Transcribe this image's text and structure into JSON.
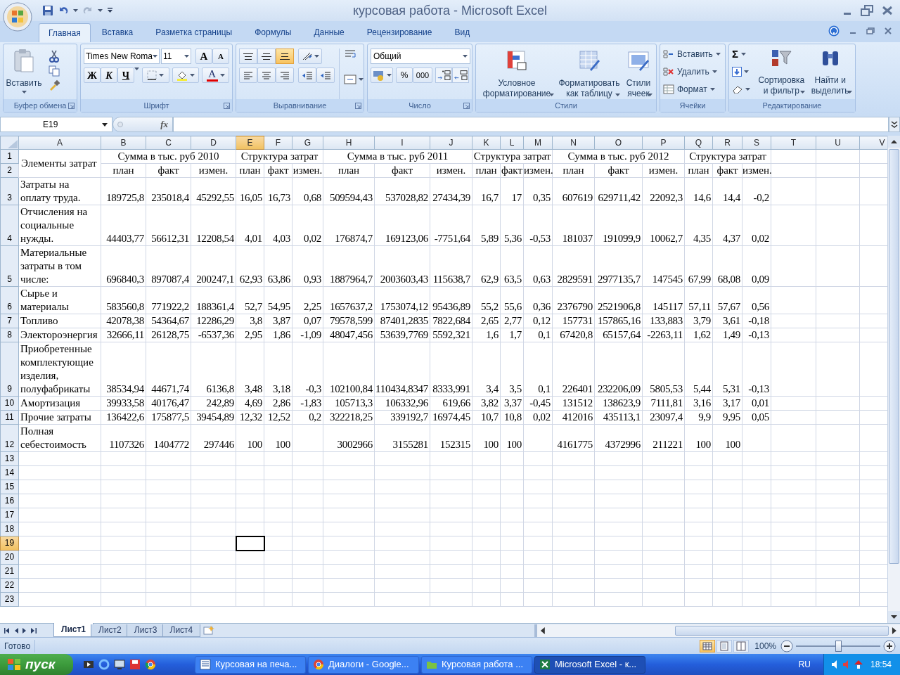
{
  "window": {
    "title": "курсовая работа - Microsoft Excel"
  },
  "ribbon_tabs": [
    {
      "label": "Главная",
      "selected": true
    },
    {
      "label": "Вставка",
      "selected": false
    },
    {
      "label": "Разметка страницы",
      "selected": false
    },
    {
      "label": "Формулы",
      "selected": false
    },
    {
      "label": "Данные",
      "selected": false
    },
    {
      "label": "Рецензирование",
      "selected": false
    },
    {
      "label": "Вид",
      "selected": false
    }
  ],
  "ribbon": {
    "clipboard": {
      "title": "Буфер обмена",
      "paste": "Вставить"
    },
    "font": {
      "title": "Шрифт",
      "font_name": "Times New Roma",
      "font_size": "11",
      "grow": "A",
      "shrink": "A",
      "bold": "Ж",
      "italic": "К",
      "underline": "Ч",
      "font_color": "A"
    },
    "alignment": {
      "title": "Выравнивание",
      "vertical_align": [
        {
          "kind": "top",
          "selected": false
        },
        {
          "kind": "middle",
          "selected": false
        },
        {
          "kind": "bottom",
          "selected": true
        }
      ]
    },
    "number": {
      "title": "Число",
      "format": "Общий",
      "percent": "%",
      "thousands": "000"
    },
    "styles": {
      "title": "Стили",
      "buttons": [
        "Условное форматирование",
        "Форматировать как таблицу",
        "Стили ячеек"
      ]
    },
    "cells": {
      "title": "Ячейки",
      "buttons": [
        "Вставить",
        "Удалить",
        "Формат"
      ]
    },
    "editing": {
      "title": "Редактирование",
      "sum": "Σ",
      "buttons": [
        "Сортировка и фильтр",
        "Найти и выделить"
      ]
    }
  },
  "formula_bar": {
    "name_box": "E19",
    "fx": "fx"
  },
  "columns": [
    {
      "label": "A",
      "selected": false
    },
    {
      "label": "B",
      "selected": false
    },
    {
      "label": "C",
      "selected": false
    },
    {
      "label": "D",
      "selected": false
    },
    {
      "label": "E",
      "selected": true
    },
    {
      "label": "F",
      "selected": false
    },
    {
      "label": "G",
      "selected": false
    },
    {
      "label": "H",
      "selected": false
    },
    {
      "label": "I",
      "selected": false
    },
    {
      "label": "J",
      "selected": false
    },
    {
      "label": "K",
      "selected": false
    },
    {
      "label": "L",
      "selected": false
    },
    {
      "label": "M",
      "selected": false
    },
    {
      "label": "N",
      "selected": false
    },
    {
      "label": "O",
      "selected": false
    },
    {
      "label": "P",
      "selected": false
    },
    {
      "label": "Q",
      "selected": false
    },
    {
      "label": "R",
      "selected": false
    },
    {
      "label": "S",
      "selected": false
    },
    {
      "label": "T",
      "selected": false
    },
    {
      "label": "U",
      "selected": false
    },
    {
      "label": "V",
      "selected": false
    }
  ],
  "header": {
    "label": "Элементы затрат",
    "row_numbers": [
      {
        "number": "1",
        "selected": false
      },
      {
        "number": "2",
        "selected": false
      }
    ],
    "groups": [
      "Сумма в тыс. руб 2010",
      "Структура затрат",
      "Сумма в тыс. руб 2011",
      "Структура затрат",
      "Сумма в тыс. руб 2012",
      "Структура затрат"
    ],
    "subheaders": [
      "план",
      "факт",
      "измен.",
      "план",
      "факт",
      "измен.",
      "план",
      "факт",
      "измен.",
      "план",
      "факт",
      "измен.",
      "план",
      "факт",
      "измен.",
      "план",
      "факт",
      "измен."
    ]
  },
  "rows": [
    {
      "number": "3",
      "selected": false,
      "label": "Затраты на оплату труда.",
      "groups": [
        [
          "189725,8",
          "235018,4",
          "45292,55"
        ],
        [
          "16,05",
          "16,73",
          "0,68"
        ],
        [
          "509594,43",
          "537028,82",
          "27434,39"
        ],
        [
          "16,7",
          "17",
          "0,35"
        ],
        [
          "607619",
          "629711,42",
          "22092,3"
        ],
        [
          "14,6",
          "14,4",
          "-0,2"
        ]
      ]
    },
    {
      "number": "4",
      "selected": false,
      "label": "Отчисления на социальные нужды.",
      "groups": [
        [
          "44403,77",
          "56612,31",
          "12208,54"
        ],
        [
          "4,01",
          "4,03",
          "0,02"
        ],
        [
          "176874,7",
          "169123,06",
          "-7751,64"
        ],
        [
          "5,89",
          "5,36",
          "-0,53"
        ],
        [
          "181037",
          "191099,9",
          "10062,7"
        ],
        [
          "4,35",
          "4,37",
          "0,02"
        ]
      ]
    },
    {
      "number": "5",
      "selected": false,
      "label": "Материальные затраты в том числе:",
      "groups": [
        [
          "696840,3",
          "897087,4",
          "200247,1"
        ],
        [
          "62,93",
          "63,86",
          "0,93"
        ],
        [
          "1887964,7",
          "2003603,43",
          "115638,7"
        ],
        [
          "62,9",
          "63,5",
          "0,63"
        ],
        [
          "2829591",
          "2977135,7",
          "147545"
        ],
        [
          "67,99",
          "68,08",
          "0,09"
        ]
      ]
    },
    {
      "number": "6",
      "selected": false,
      "label": "Сырье и материалы",
      "groups": [
        [
          "583560,8",
          "771922,2",
          "188361,4"
        ],
        [
          "52,7",
          "54,95",
          "2,25"
        ],
        [
          "1657637,2",
          "1753074,12",
          "95436,89"
        ],
        [
          "55,2",
          "55,6",
          "0,36"
        ],
        [
          "2376790",
          "2521906,8",
          "145117"
        ],
        [
          "57,11",
          "57,67",
          "0,56"
        ]
      ]
    },
    {
      "number": "7",
      "selected": false,
      "label": "Топливо",
      "groups": [
        [
          "42078,38",
          "54364,67",
          "12286,29"
        ],
        [
          "3,8",
          "3,87",
          "0,07"
        ],
        [
          "79578,599",
          "87401,2835",
          "7822,684"
        ],
        [
          "2,65",
          "2,77",
          "0,12"
        ],
        [
          "157731",
          "157865,16",
          "133,883"
        ],
        [
          "3,79",
          "3,61",
          "-0,18"
        ]
      ]
    },
    {
      "number": "8",
      "selected": false,
      "label": "Электороэнергия",
      "groups": [
        [
          "32666,11",
          "26128,75",
          "-6537,36"
        ],
        [
          "2,95",
          "1,86",
          "-1,09"
        ],
        [
          "48047,456",
          "53639,7769",
          "5592,321"
        ],
        [
          "1,6",
          "1,7",
          "0,1"
        ],
        [
          "67420,8",
          "65157,64",
          "-2263,11"
        ],
        [
          "1,62",
          "1,49",
          "-0,13"
        ]
      ]
    },
    {
      "number": "9",
      "selected": false,
      "label": "Приобретенные комплектующие изделия, полуфабрикаты",
      "groups": [
        [
          "38534,94",
          "44671,74",
          "6136,8"
        ],
        [
          "3,48",
          "3,18",
          "-0,3"
        ],
        [
          "102100,84",
          "110434,8347",
          "8333,991"
        ],
        [
          "3,4",
          "3,5",
          "0,1"
        ],
        [
          "226401",
          "232206,09",
          "5805,53"
        ],
        [
          "5,44",
          "5,31",
          "-0,13"
        ]
      ]
    },
    {
      "number": "10",
      "selected": false,
      "label": "Амортизация",
      "groups": [
        [
          "39933,58",
          "40176,47",
          "242,89"
        ],
        [
          "4,69",
          "2,86",
          "-1,83"
        ],
        [
          "105713,3",
          "106332,96",
          "619,66"
        ],
        [
          "3,82",
          "3,37",
          "-0,45"
        ],
        [
          "131512",
          "138623,9",
          "7111,81"
        ],
        [
          "3,16",
          "3,17",
          "0,01"
        ]
      ]
    },
    {
      "number": "11",
      "selected": false,
      "label": "Прочие затраты",
      "groups": [
        [
          "136422,6",
          "175877,5",
          "39454,89"
        ],
        [
          "12,32",
          "12,52",
          "0,2"
        ],
        [
          "322218,25",
          "339192,7",
          "16974,45"
        ],
        [
          "10,7",
          "10,8",
          "0,02"
        ],
        [
          "412016",
          "435113,1",
          "23097,4"
        ],
        [
          "9,9",
          "9,95",
          "0,05"
        ]
      ]
    },
    {
      "number": "12",
      "selected": false,
      "label": "Полная себестоимость",
      "groups": [
        [
          "1107326",
          "1404772",
          "297446"
        ],
        [
          "100",
          "100"
        ],
        [
          "3002966",
          "3155281",
          "152315"
        ],
        [
          "100",
          "100"
        ],
        [
          "4161775",
          "4372996",
          "211221"
        ],
        [
          "100",
          "100"
        ]
      ]
    }
  ],
  "empty_rows": [
    {
      "number": "13",
      "selected": false
    },
    {
      "number": "14",
      "selected": false
    },
    {
      "number": "15",
      "selected": false
    },
    {
      "number": "16",
      "selected": false
    },
    {
      "number": "17",
      "selected": false
    },
    {
      "number": "18",
      "selected": false
    },
    {
      "number": "19",
      "selected": true
    },
    {
      "number": "20",
      "selected": false
    },
    {
      "number": "21",
      "selected": false
    },
    {
      "number": "22",
      "selected": false
    },
    {
      "number": "23",
      "selected": false
    }
  ],
  "sheet_tabs": [
    {
      "label": "Лист1",
      "selected": true
    },
    {
      "label": "Лист2",
      "selected": false
    },
    {
      "label": "Лист3",
      "selected": false
    },
    {
      "label": "Лист4",
      "selected": false
    }
  ],
  "status_bar": {
    "text": "Готово",
    "views": [
      {
        "kind": "normal",
        "selected": true
      },
      {
        "kind": "layout",
        "selected": false
      },
      {
        "kind": "page_break",
        "selected": false
      }
    ],
    "zoom": "100%",
    "level": 0.5
  },
  "taskbar": {
    "start": "пуск",
    "tasks": [
      {
        "kind": "word",
        "label": "Курсовая на печа...",
        "selected": false
      },
      {
        "kind": "chrome",
        "label": "Диалоги - Google...",
        "selected": false
      },
      {
        "kind": "folder",
        "label": "Курсовая работа ...",
        "selected": false
      },
      {
        "kind": "excel",
        "label": "Microsoft Excel - к...",
        "selected": true
      }
    ],
    "language": "RU",
    "clock": "18:54"
  }
}
